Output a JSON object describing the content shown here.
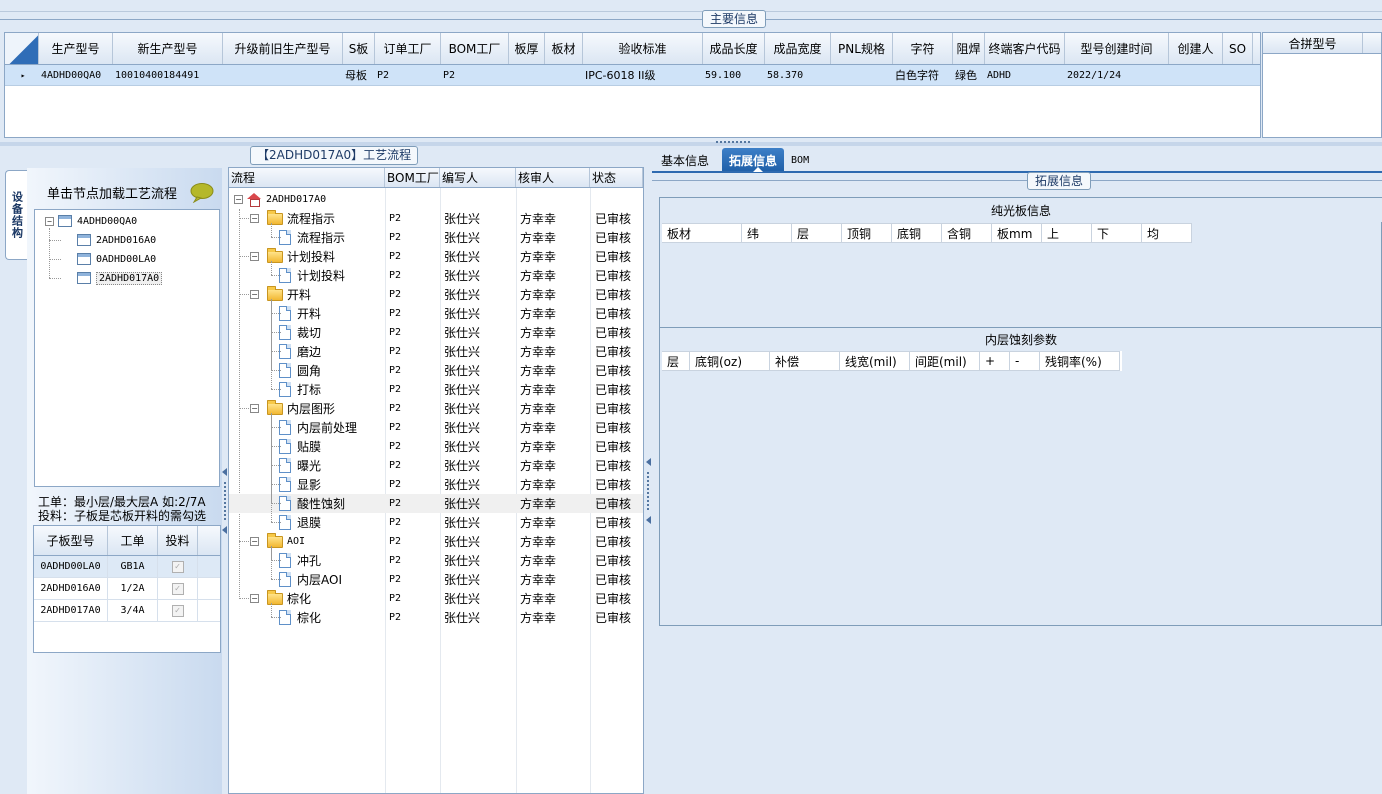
{
  "main_group_title": "主要信息",
  "main_columns": [
    "生产型号",
    "新生产型号",
    "升级前旧生产型号",
    "S板",
    "订单工厂",
    "BOM工厂",
    "板厚",
    "板材",
    "验收标准",
    "成品长度",
    "成品宽度",
    "PNL规格",
    "字符",
    "阻焊",
    "终端客户代码",
    "型号创建时间",
    "创建人",
    "SO"
  ],
  "main_row": {
    "marker": "▸",
    "cells": [
      "4ADHD00QA0",
      "10010400184491",
      "",
      "母板",
      "P2",
      "P2",
      "",
      "",
      "IPC-6018 II级",
      "59.100",
      "58.370",
      "",
      "白色字符",
      "绿色",
      "ADHD",
      "2022/1/24",
      "",
      ""
    ]
  },
  "merge_column": "合拼型号",
  "device_side_tab": "设备结构",
  "device_hint": "单击节点加载工艺流程",
  "device_tree": {
    "root": "4ADHD00QA0",
    "children": [
      "2ADHD016A0",
      "0ADHD00LA0",
      "2ADHD017A0"
    ]
  },
  "note_line1": "工单：最小层/最大层A 如:2/7A",
  "note_line2": "投料：子板是芯板开料的需勾选",
  "sub_columns": [
    "子板型号",
    "工单",
    "投料"
  ],
  "sub_rows": [
    {
      "model": "0ADHD00LA0",
      "order": "GB1A",
      "check": "✓"
    },
    {
      "model": "2ADHD016A0",
      "order": "1/2A",
      "check": "✓"
    },
    {
      "model": "2ADHD017A0",
      "order": "3/4A",
      "check": "✓"
    }
  ],
  "flow_title": "【2ADHD017A0】工艺流程",
  "flow_columns": [
    "流程",
    "BOM工厂",
    "编写人",
    "核审人",
    "状态"
  ],
  "flow_root": "2ADHD017A0",
  "flow_rows": [
    {
      "name": "流程指示",
      "bom": "P2",
      "author": "张仕兴",
      "reviewer": "方幸幸",
      "status": "已审核"
    },
    {
      "name": "流程指示",
      "bom": "P2",
      "author": "张仕兴",
      "reviewer": "方幸幸",
      "status": "已审核"
    },
    {
      "name": "计划投料",
      "bom": "P2",
      "author": "张仕兴",
      "reviewer": "方幸幸",
      "status": "已审核"
    },
    {
      "name": "计划投料",
      "bom": "P2",
      "author": "张仕兴",
      "reviewer": "方幸幸",
      "status": "已审核"
    },
    {
      "name": "开料",
      "bom": "P2",
      "author": "张仕兴",
      "reviewer": "方幸幸",
      "status": "已审核"
    },
    {
      "name": "开料",
      "bom": "P2",
      "author": "张仕兴",
      "reviewer": "方幸幸",
      "status": "已审核"
    },
    {
      "name": "裁切",
      "bom": "P2",
      "author": "张仕兴",
      "reviewer": "方幸幸",
      "status": "已审核"
    },
    {
      "name": "磨边",
      "bom": "P2",
      "author": "张仕兴",
      "reviewer": "方幸幸",
      "status": "已审核"
    },
    {
      "name": "圆角",
      "bom": "P2",
      "author": "张仕兴",
      "reviewer": "方幸幸",
      "status": "已审核"
    },
    {
      "name": "打标",
      "bom": "P2",
      "author": "张仕兴",
      "reviewer": "方幸幸",
      "status": "已审核"
    },
    {
      "name": "内层图形",
      "bom": "P2",
      "author": "张仕兴",
      "reviewer": "方幸幸",
      "status": "已审核"
    },
    {
      "name": "内层前处理",
      "bom": "P2",
      "author": "张仕兴",
      "reviewer": "方幸幸",
      "status": "已审核"
    },
    {
      "name": "贴膜",
      "bom": "P2",
      "author": "张仕兴",
      "reviewer": "方幸幸",
      "status": "已审核"
    },
    {
      "name": "曝光",
      "bom": "P2",
      "author": "张仕兴",
      "reviewer": "方幸幸",
      "status": "已审核"
    },
    {
      "name": "显影",
      "bom": "P2",
      "author": "张仕兴",
      "reviewer": "方幸幸",
      "status": "已审核"
    },
    {
      "name": "酸性蚀刻",
      "bom": "P2",
      "author": "张仕兴",
      "reviewer": "方幸幸",
      "status": "已审核"
    },
    {
      "name": "退膜",
      "bom": "P2",
      "author": "张仕兴",
      "reviewer": "方幸幸",
      "status": "已审核"
    },
    {
      "name": "AOI",
      "bom": "P2",
      "author": "张仕兴",
      "reviewer": "方幸幸",
      "status": "已审核"
    },
    {
      "name": "冲孔",
      "bom": "P2",
      "author": "张仕兴",
      "reviewer": "方幸幸",
      "status": "已审核"
    },
    {
      "name": "内层AOI",
      "bom": "P2",
      "author": "张仕兴",
      "reviewer": "方幸幸",
      "status": "已审核"
    },
    {
      "name": "棕化",
      "bom": "P2",
      "author": "张仕兴",
      "reviewer": "方幸幸",
      "status": "已审核"
    },
    {
      "name": "棕化",
      "bom": "P2",
      "author": "张仕兴",
      "reviewer": "方幸幸",
      "status": "已审核"
    }
  ],
  "tabs": [
    "基本信息",
    "拓展信息",
    "BOM"
  ],
  "ext_group_title": "拓展信息",
  "bare_board_title": "纯光板信息",
  "bare_board_columns": [
    "板材",
    "纬",
    "层",
    "顶铜",
    "底铜",
    "含铜",
    "板mm",
    "上",
    "下",
    "均"
  ],
  "inner_etch_title": "内层蚀刻参数",
  "inner_etch_columns": [
    "层",
    "底铜(oz)",
    "补偿",
    "线宽(mil)",
    "间距(mil)",
    "+",
    "-",
    "残铜率(%)"
  ]
}
